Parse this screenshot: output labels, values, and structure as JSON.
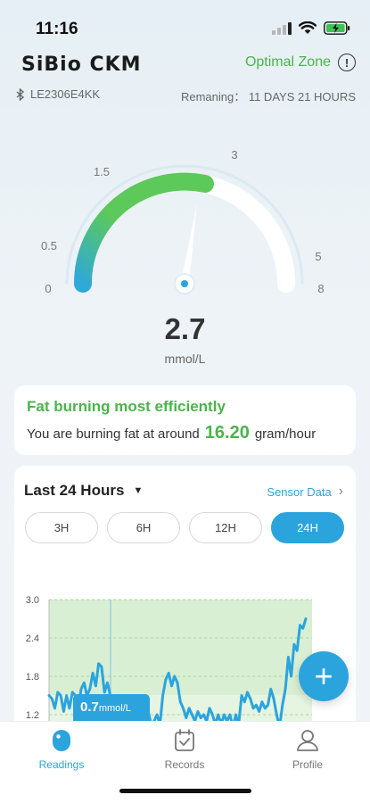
{
  "status_bar": {
    "time": "11:16"
  },
  "header": {
    "app_title": "SiBio CKM",
    "zone_label": "Optimal Zone",
    "device_id": "LE2306E4KK",
    "remaining": "Remaning： 11 DAYS 21 HOURS"
  },
  "gauge": {
    "value": 2.7,
    "unit": "mmol/L",
    "tick_labels": [
      "0",
      "0.5",
      "1.5",
      "3",
      "5",
      "8"
    ],
    "colors": {
      "fill_start": "#2fa9d8",
      "fill_end": "#5cc95a",
      "track": "#ffffff",
      "halo": "#dbe9f1"
    }
  },
  "fat_card": {
    "title": "Fat burning most efficiently",
    "text_prefix": "You are burning fat at around",
    "value": "16.20",
    "unit": "gram/hour"
  },
  "chart_card": {
    "period": "Last 24 Hours",
    "sensor_link": "Sensor Data",
    "tabs": [
      "3H",
      "6H",
      "12H",
      "24H"
    ],
    "active_tab": "24H",
    "tooltip_value": "0.7",
    "tooltip_unit": "mmol/L"
  },
  "chart_data": {
    "type": "line",
    "y_ticks": [
      "3.0",
      "2.4",
      "1.8",
      "1.2"
    ],
    "ylim": [
      0.6,
      3.0
    ],
    "zone_band": [
      0.6,
      3.0
    ],
    "inner_band": [
      1.2,
      3.0
    ],
    "series": [
      {
        "color": "#2ba4dd",
        "values": [
          1.5,
          1.45,
          1.3,
          1.55,
          1.5,
          1.25,
          1.5,
          1.3,
          1.55,
          1.5,
          1.3,
          1.6,
          1.7,
          1.5,
          1.6,
          1.85,
          1.65,
          2.0,
          1.95,
          1.55,
          1.7,
          1.5,
          1.5,
          1.3,
          1.3,
          1.2,
          1.0,
          1.1,
          1.0,
          1.05,
          1.0,
          1.05,
          1.15,
          1.1,
          1.25,
          1.05,
          1.1,
          1.2,
          1.05,
          1.5,
          1.75,
          1.85,
          1.65,
          1.8,
          1.7,
          1.4,
          1.3,
          1.15,
          1.3,
          1.2,
          1.1,
          1.25,
          1.15,
          1.2,
          1.1,
          1.3,
          1.2,
          1.05,
          1.2,
          1.05,
          1.2,
          1.1,
          1.2,
          1.0,
          1.2,
          1.05,
          1.5,
          1.4,
          1.55,
          1.45,
          1.3,
          1.35,
          1.25,
          1.4,
          1.3,
          1.35,
          1.6,
          1.45,
          1.2,
          1.0,
          1.35,
          1.6,
          2.1,
          1.8,
          2.3,
          2.2,
          2.6,
          2.55,
          2.7
        ]
      }
    ]
  },
  "fab": {
    "label": "+"
  },
  "tab_bar": {
    "items": [
      "Readings",
      "Records",
      "Profile"
    ],
    "active": "Readings"
  }
}
